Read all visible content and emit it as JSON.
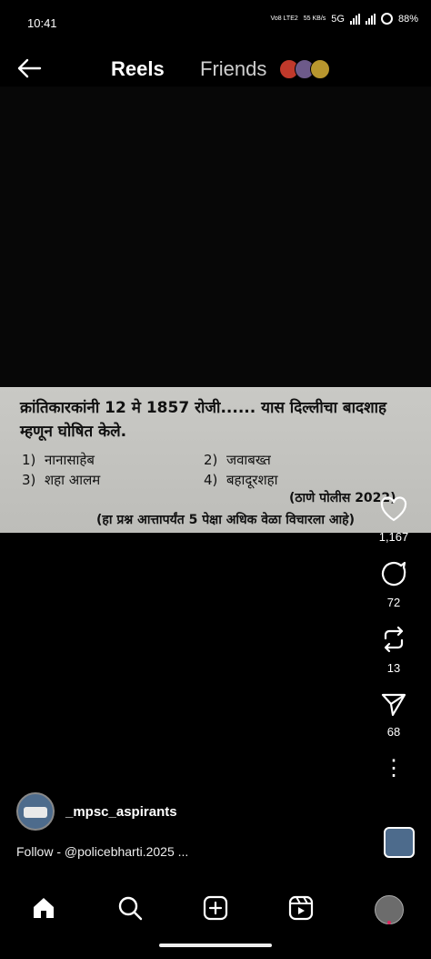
{
  "status_bar": {
    "time": "10:41",
    "net_top": "Vo8 LTE2",
    "speed": "55 KB/s",
    "network": "5G",
    "battery": "88%"
  },
  "top_nav": {
    "tab_reels": "Reels",
    "tab_friends": "Friends"
  },
  "post": {
    "question": "क्रांतिकारकांनी 12 मे 1857 रोजी...... यास दिल्लीचा बादशाह म्हणून घोषित केले.",
    "options": [
      {
        "num": "1)",
        "text": "नानासाहेब"
      },
      {
        "num": "2)",
        "text": "जवाबख्त"
      },
      {
        "num": "3)",
        "text": "शहा आलम"
      },
      {
        "num": "4)",
        "text": "बहादूरशहा"
      }
    ],
    "source": "(ठाणे पोलीस 2022)",
    "note": "(हा प्रश्न आत्तापर्यंत 5 पेक्षा अधिक वेळा विचारला आहे)"
  },
  "actions": {
    "likes": "1,167",
    "comments": "72",
    "reposts": "13",
    "shares": "68",
    "more_label": "⋮"
  },
  "author": {
    "username": "_mpsc_aspirants",
    "caption": "Follow - @policebharti.2025 ..."
  },
  "colors": {
    "background": "#000000",
    "post_bg": "#c6c6c2",
    "text": "#ffffff",
    "notification": "#e0245e"
  },
  "icons": [
    "back-arrow-icon",
    "heart-icon",
    "comment-icon",
    "repost-icon",
    "share-icon",
    "more-icon",
    "home-icon",
    "search-icon",
    "create-icon",
    "reels-icon"
  ]
}
